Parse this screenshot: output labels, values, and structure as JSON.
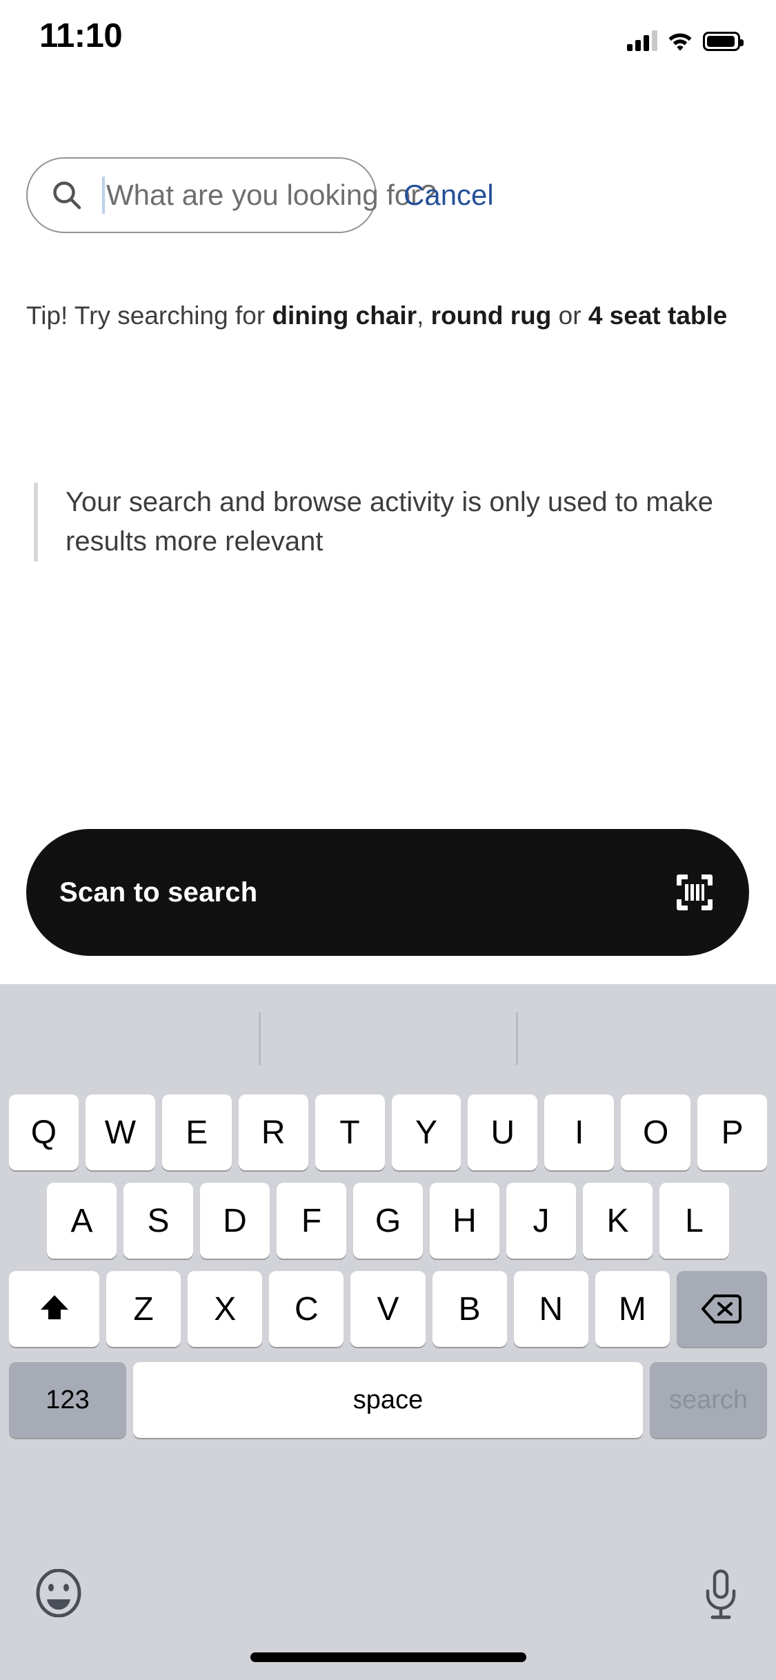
{
  "status_bar": {
    "time": "11:10",
    "signal_icon": "cellular-bars-icon",
    "signal_bars_filled": 3,
    "signal_bars_total": 4,
    "wifi_icon": "wifi-icon",
    "battery_icon": "battery-icon",
    "battery_level_percent": 88
  },
  "search": {
    "icon": "search-icon",
    "value": "",
    "placeholder": "What are you looking for?",
    "cancel_label": "Cancel",
    "cancel_color": "#245099"
  },
  "tip": {
    "prefix": "Tip! Try searching for ",
    "term1": "dining chair",
    "separator1": ", ",
    "term2": "round rug",
    "separator2": " or ",
    "term3": "4 seat table"
  },
  "privacy": {
    "text": "Your search and browse activity is only used to make results more relevant",
    "accent_color": "#d7d7d7"
  },
  "scan": {
    "label": "Scan to search",
    "icon": "barcode-scan-icon",
    "background_color": "#111111",
    "text_color": "#ffffff"
  },
  "keyboard": {
    "background_color": "#d1d3d8",
    "row1": [
      "Q",
      "W",
      "E",
      "R",
      "T",
      "Y",
      "U",
      "I",
      "O",
      "P"
    ],
    "row2": [
      "A",
      "S",
      "D",
      "F",
      "G",
      "H",
      "J",
      "K",
      "L"
    ],
    "row3_letters": [
      "Z",
      "X",
      "C",
      "V",
      "B",
      "N",
      "M"
    ],
    "shift_icon": "shift-arrow-icon",
    "backspace_icon": "backspace-icon",
    "numbers_label": "123",
    "space_label": "space",
    "return_label": "search",
    "return_disabled": true,
    "emoji_icon": "emoji-smiley-icon",
    "dictation_icon": "microphone-icon",
    "home_indicator": "home-indicator"
  }
}
